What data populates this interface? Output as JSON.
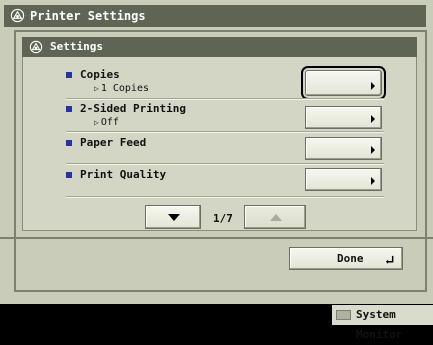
{
  "window": {
    "title": "Printer Settings"
  },
  "panel": {
    "title": "Settings"
  },
  "settings": [
    {
      "label": "Copies",
      "value": "1 Copies"
    },
    {
      "label": "2-Sided Printing",
      "value": "Off"
    },
    {
      "label": "Paper Feed",
      "value": ""
    },
    {
      "label": "Print Quality",
      "value": ""
    }
  ],
  "pager": {
    "indicator": "1/7"
  },
  "footer": {
    "done_label": "Done"
  },
  "status": {
    "system_monitor_label": "System Monitor"
  },
  "colors": {
    "title_bar": "#5f6555",
    "background": "#c8ccb8",
    "bullet": "#28339e"
  },
  "icons": {
    "title": "printer-settings-icon",
    "done": "return-arrow-icon",
    "pager_down": "triangle-down-icon",
    "pager_up": "triangle-up-icon"
  }
}
